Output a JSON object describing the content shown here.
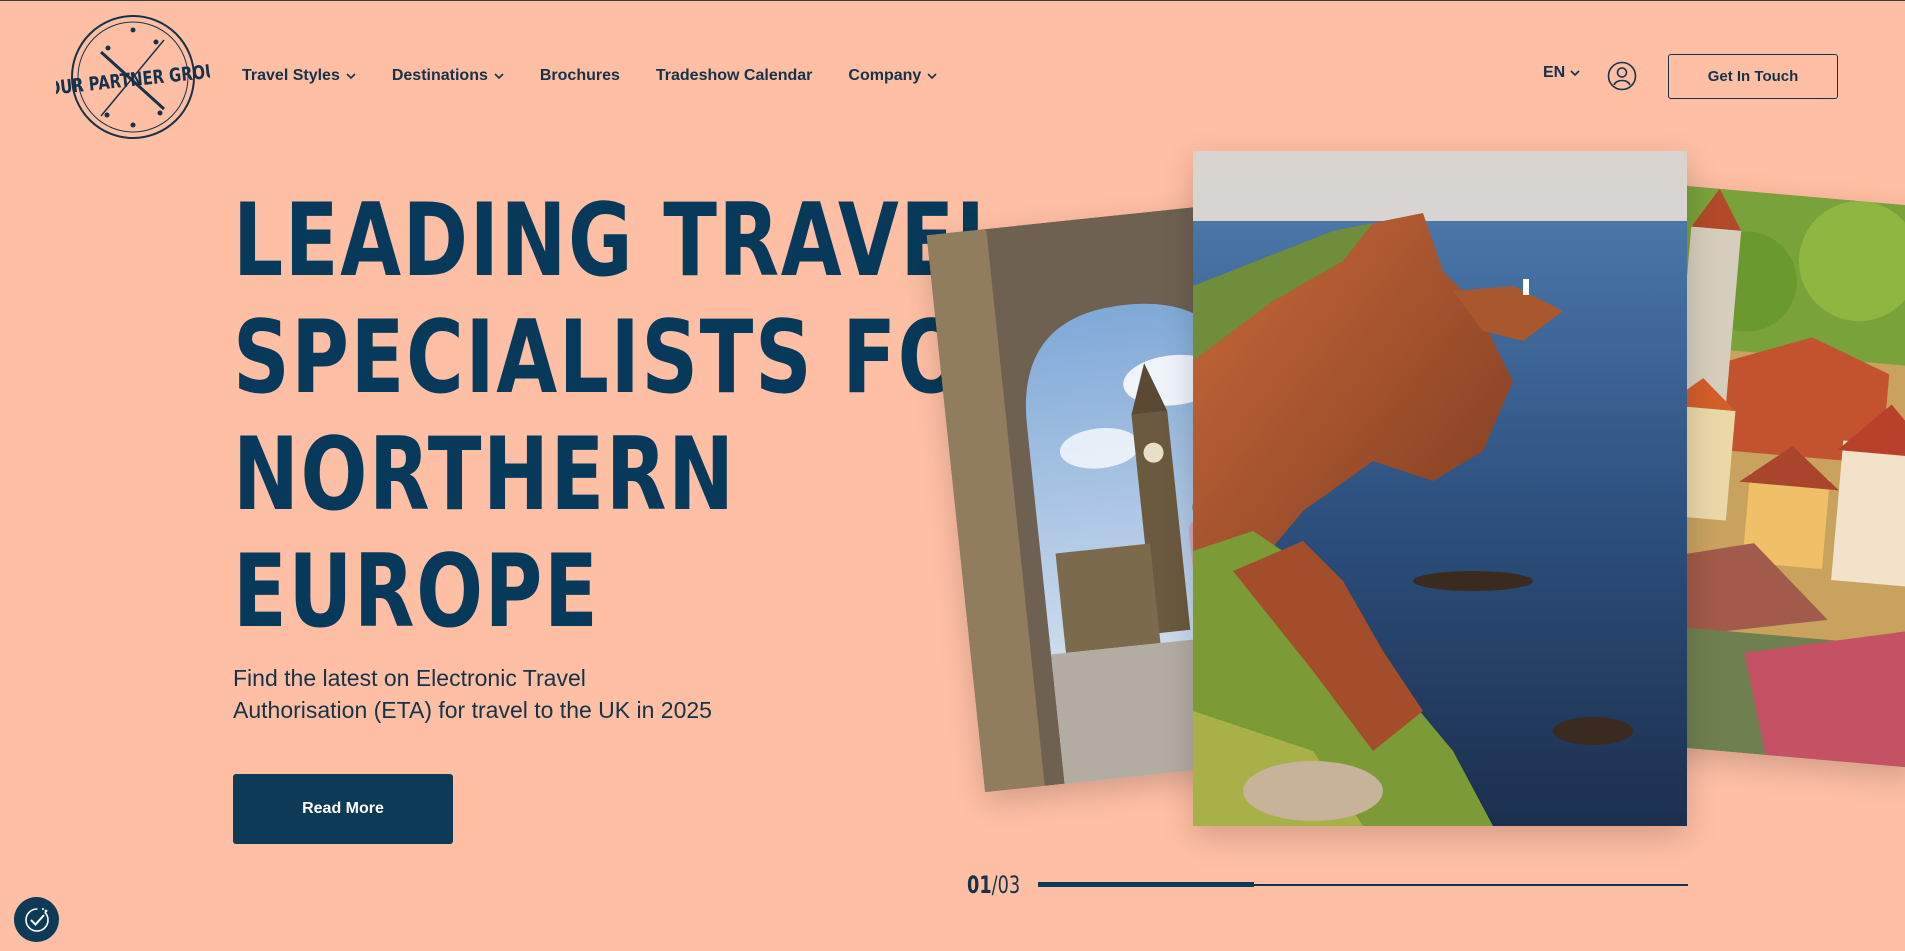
{
  "brand": {
    "logo_text": "TOUR PARTNER GROUP"
  },
  "nav": {
    "items": [
      {
        "label": "Travel Styles",
        "has_dropdown": true
      },
      {
        "label": "Destinations",
        "has_dropdown": true
      },
      {
        "label": "Brochures",
        "has_dropdown": false
      },
      {
        "label": "Tradeshow Calendar",
        "has_dropdown": false
      },
      {
        "label": "Company",
        "has_dropdown": true
      }
    ]
  },
  "header": {
    "language": "EN",
    "user_icon": "user-circle-icon",
    "cta_label": "Get In Touch"
  },
  "hero": {
    "headline_lines": [
      "LEADING TRAVEL",
      "SPECIALISTS FOR",
      "NORTHERN",
      "EUROPE"
    ],
    "subtitle_line1": "Find the latest on Electronic Travel",
    "subtitle_line2": "Authorisation (ETA) for travel to the UK in 2025",
    "button_label": "Read More"
  },
  "slider": {
    "current": "01",
    "separator": "/",
    "total": "03",
    "progress": 0.333,
    "slides": [
      "london-big-ben-image",
      "coastal-cliffs-lighthouse-image",
      "old-town-rooftops-image"
    ]
  },
  "cookie_widget": {
    "icon": "cookie-consent-icon"
  },
  "colors": {
    "background": "#ffbfa4",
    "primary": "#0d3a57",
    "text": "#15324a"
  }
}
